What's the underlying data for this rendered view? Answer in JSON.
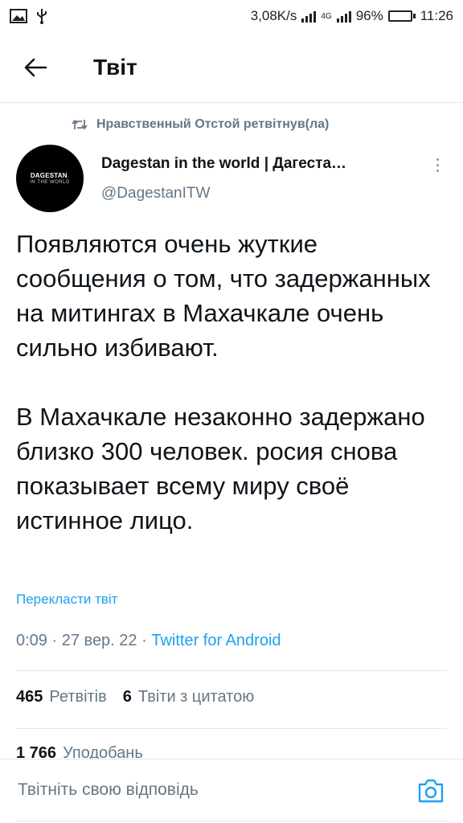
{
  "status_bar": {
    "net_speed": "3,08K/s",
    "network_type": "4G",
    "battery": "96%",
    "battery_level": 0.96,
    "time": "11:26",
    "icons": [
      "image-icon",
      "usb-icon",
      "signal-icon",
      "battery-icon"
    ]
  },
  "header": {
    "back_icon": "arrow-left-icon",
    "title": "Твіт"
  },
  "tweet": {
    "retweet_label": "Нравственный Отстой ретвітнув(ла)",
    "author": {
      "avatar_line1": "DAGESTAN",
      "avatar_line2": "IN THE WORLD",
      "name": "Dagestan in the world | Дагеста…",
      "handle": "@DagestanITW"
    },
    "paragraphs": [
      "Появляются очень жуткие сообщения о том, что задержанных на митингах в Махачкале очень сильно избивают.",
      "В Махачкале незаконно задержано близко 300 человек. росия снова показывает всему миру своё истинное лицо."
    ],
    "translate_label": "Перекласти твіт",
    "time": "0:09",
    "date": "27 вер. 22",
    "separator": "·",
    "source": "Twitter for Android",
    "retweets_count": "465",
    "retweets_label": "Ретвітів",
    "quotes_count": "6",
    "quotes_label": "Твіти з цитатою",
    "likes_count": "1 766",
    "likes_label": "Уподобань"
  },
  "reply": {
    "placeholder": "Твітніть свою відповідь",
    "camera_icon": "camera-icon"
  },
  "colors": {
    "accent": "#1da1f2",
    "secondary_text": "#657786",
    "primary_text": "#0f1419",
    "divider": "#e1e8ed",
    "battery_fill": "#2dbb3a"
  }
}
